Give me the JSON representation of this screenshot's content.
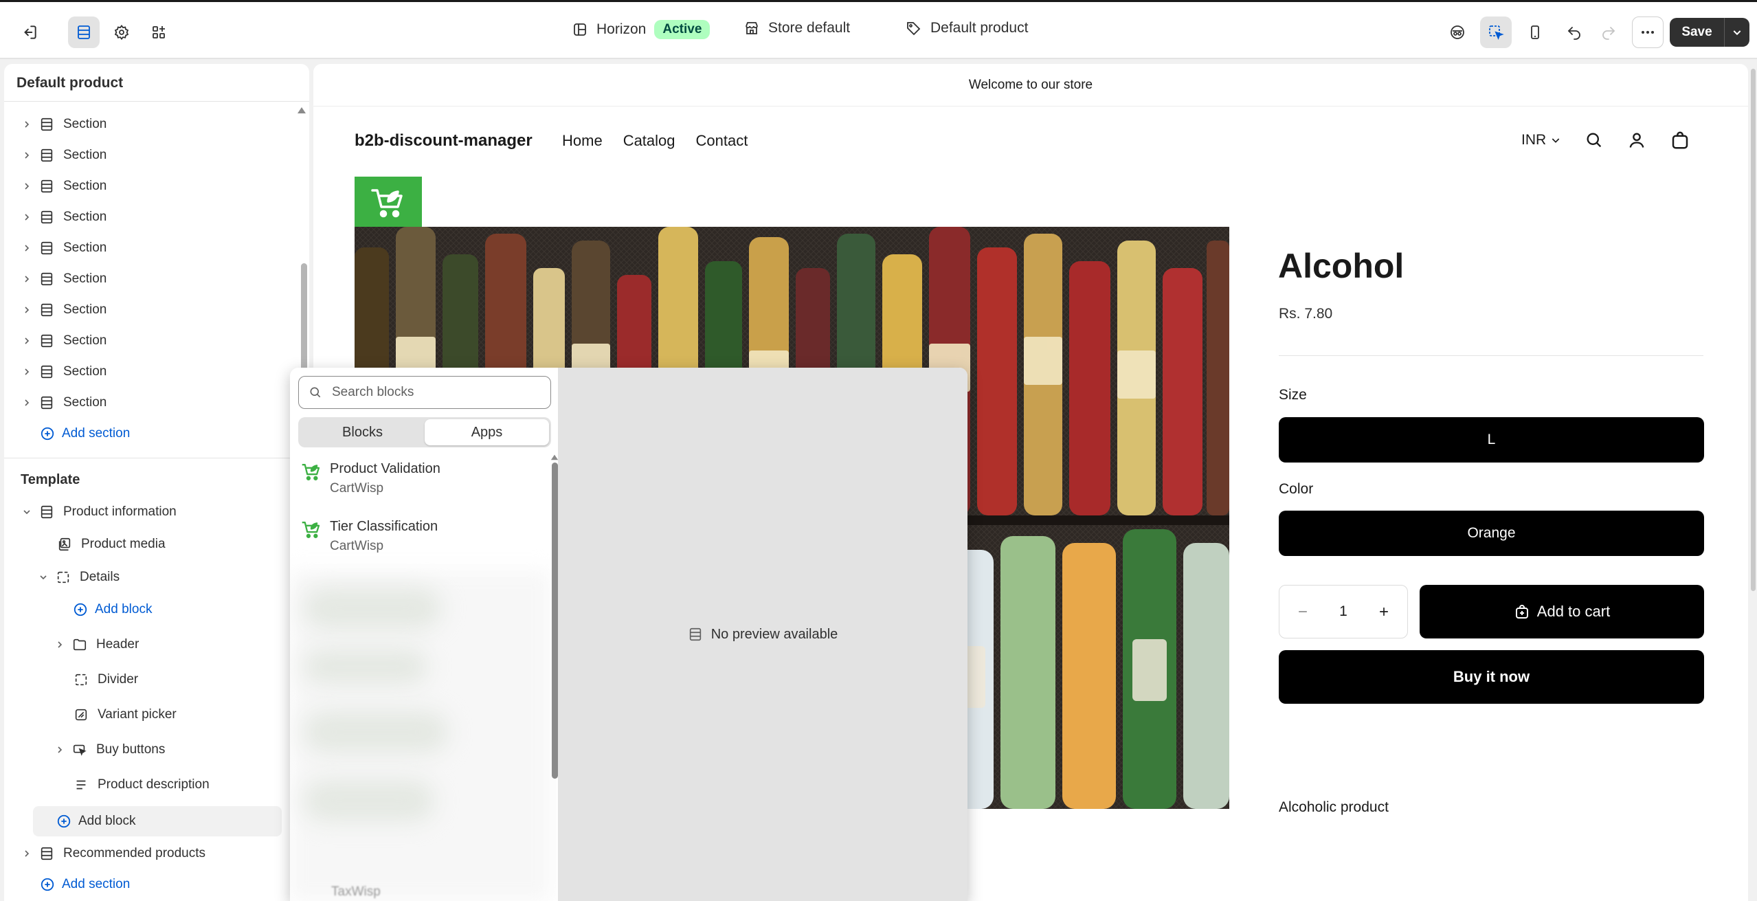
{
  "topbar": {
    "theme_name": "Horizon",
    "theme_status": "Active",
    "store_label": "Store default",
    "template_label": "Default product",
    "save_label": "Save"
  },
  "sidebar": {
    "title": "Default product",
    "sections": [
      "Section",
      "Section",
      "Section",
      "Section",
      "Section",
      "Section",
      "Section",
      "Section",
      "Section",
      "Section"
    ],
    "add_section_label": "Add section",
    "template_heading": "Template",
    "template": {
      "product_information": "Product information",
      "product_media": "Product media",
      "details": "Details",
      "add_block_inner": "Add block",
      "header": "Header",
      "divider": "Divider",
      "variant_picker": "Variant picker",
      "buy_buttons": "Buy buttons",
      "product_description": "Product description",
      "add_block": "Add block",
      "recommended_products": "Recommended products",
      "add_section_bottom": "Add section"
    }
  },
  "block_picker": {
    "search_placeholder": "Search blocks",
    "tabs": [
      "Blocks",
      "Apps"
    ],
    "active_tab": "Apps",
    "apps": [
      {
        "name": "Product Validation",
        "vendor": "CartWisp"
      },
      {
        "name": "Tier Classification",
        "vendor": "CartWisp"
      }
    ],
    "partial_vendor": "TaxWisp",
    "no_preview_text": "No preview available"
  },
  "store": {
    "announcement": "Welcome to our store",
    "name": "b2b-discount-manager",
    "nav": [
      "Home",
      "Catalog",
      "Contact"
    ],
    "currency": "INR"
  },
  "product": {
    "title": "Alcohol",
    "price": "Rs. 7.80",
    "size_label": "Size",
    "size_value": "L",
    "color_label": "Color",
    "color_value": "Orange",
    "quantity": "1",
    "add_to_cart": "Add to cart",
    "buy_now": "Buy it now",
    "description": "Alcoholic product"
  },
  "colors": {
    "accent_link": "#005bd3",
    "active_badge_bg": "#affebf",
    "primary_button": "#000000",
    "logo_green": "#3cb043"
  }
}
